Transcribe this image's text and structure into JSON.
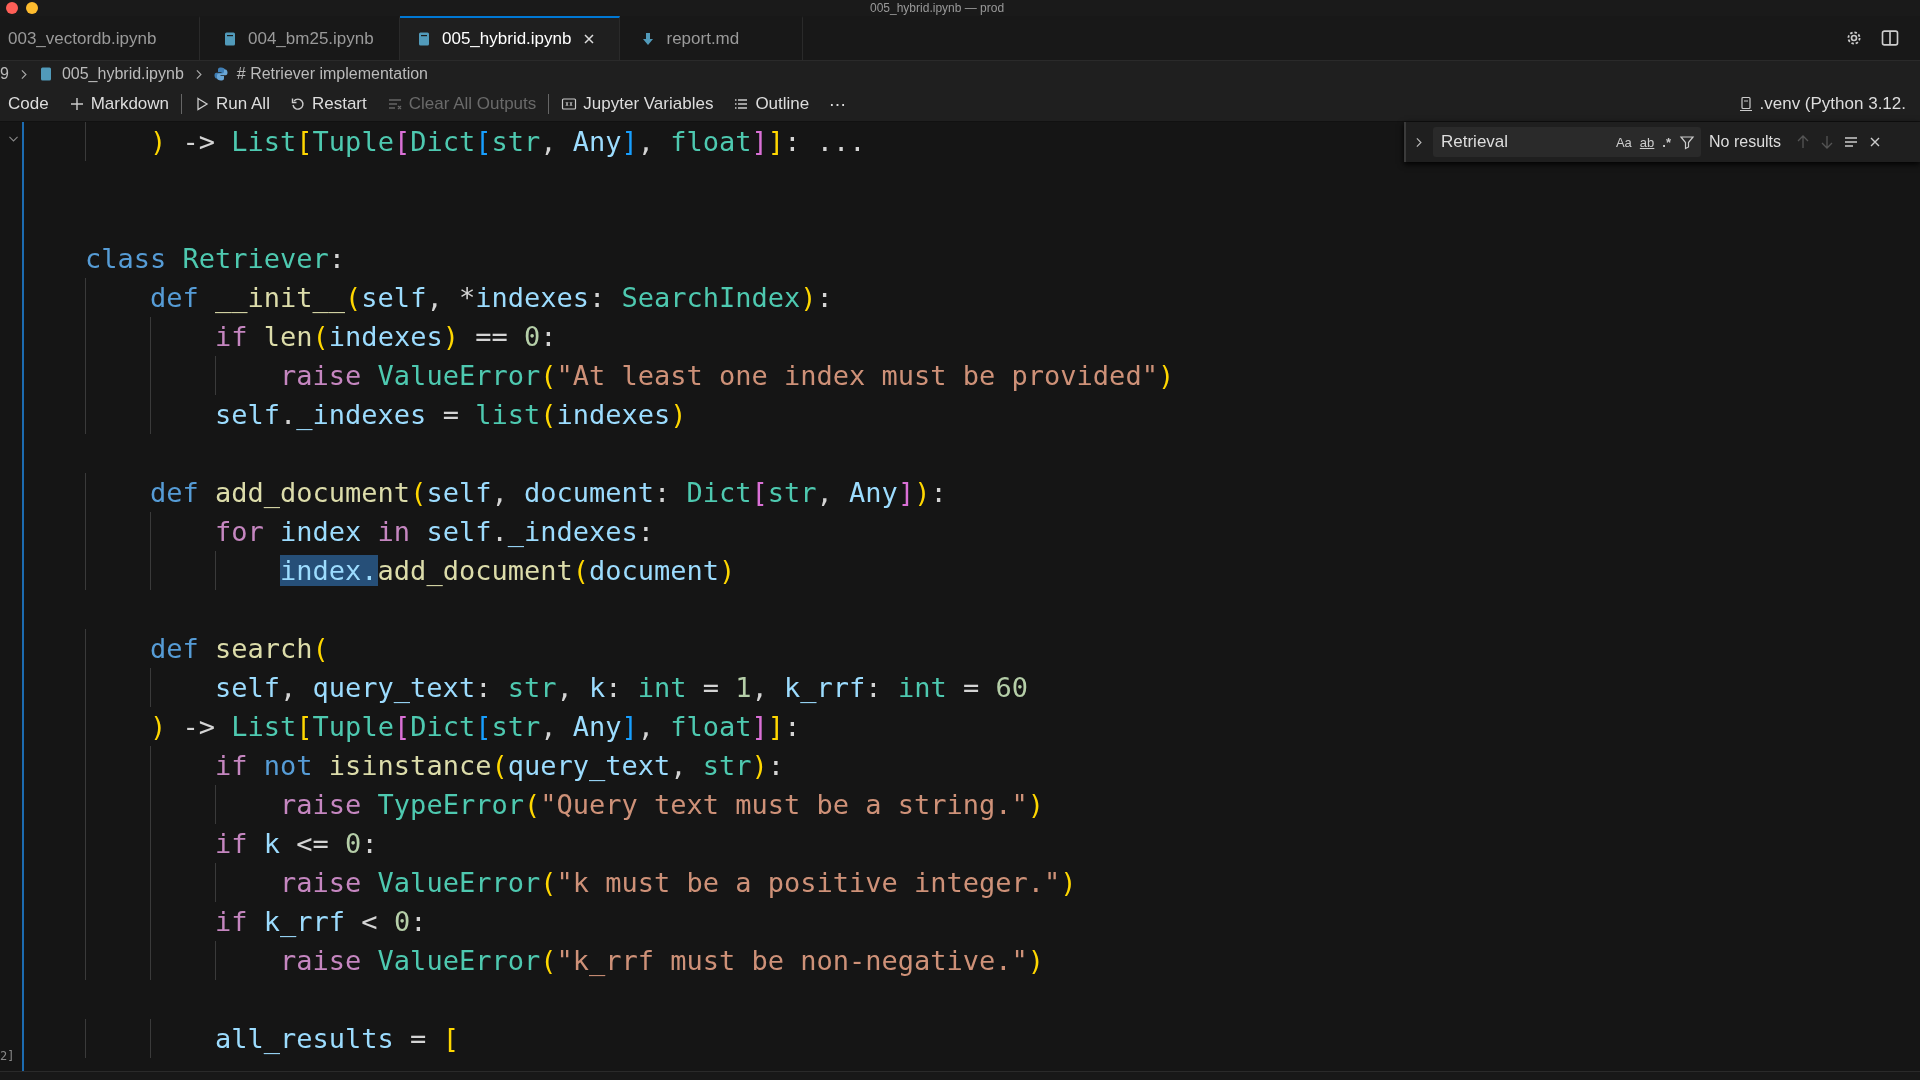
{
  "window": {
    "title": "005_hybrid.ipynb — prod"
  },
  "tabs": [
    {
      "label": "003_vectordb.ipynb",
      "kind": "plain",
      "selected": false
    },
    {
      "label": "004_bm25.ipynb",
      "kind": "notebook",
      "selected": false
    },
    {
      "label": "005_hybrid.ipynb",
      "kind": "notebook",
      "selected": true
    },
    {
      "label": "report.md",
      "kind": "markdown",
      "selected": false
    }
  ],
  "breadcrumb": [
    {
      "label": "9",
      "kind": "plain"
    },
    {
      "label": "005_hybrid.ipynb",
      "kind": "notebook"
    },
    {
      "label": "# Retriever implementation",
      "kind": "python"
    }
  ],
  "toolbar": [
    {
      "label": "Code",
      "kind": "plain",
      "disabled": false
    },
    {
      "label": "Markdown",
      "kind": "plus",
      "disabled": false
    },
    {
      "kind": "separator"
    },
    {
      "label": "Run All",
      "kind": "run",
      "disabled": false
    },
    {
      "label": "Restart",
      "kind": "restart",
      "disabled": false
    },
    {
      "label": "Clear All Outputs",
      "kind": "clear",
      "disabled": true
    },
    {
      "kind": "separator"
    },
    {
      "label": "Jupyter Variables",
      "kind": "variables",
      "disabled": false
    },
    {
      "label": "Outline",
      "kind": "outline",
      "disabled": false
    },
    {
      "label": "⋯",
      "kind": "plain",
      "disabled": false
    }
  ],
  "kernel": {
    "label": ".venv (Python 3.12."
  },
  "find": {
    "value": "Retrieval",
    "options": [
      "Aa",
      "ab",
      ".*"
    ],
    "result": "No results"
  },
  "cell_label": "2]",
  "code": [
    {
      "kind": "group",
      "children": [
        {
          "kind": "code",
          "tokens": [
            {
              "kind": "b1",
              "text": ")"
            },
            {
              "kind": "op",
              "text": " -> "
            },
            {
              "kind": "cls",
              "text": "List"
            },
            {
              "kind": "b1",
              "text": "["
            },
            {
              "kind": "cls",
              "text": "Tuple"
            },
            {
              "kind": "b2",
              "text": "["
            },
            {
              "kind": "cls",
              "text": "Dict"
            },
            {
              "kind": "b3",
              "text": "["
            },
            {
              "kind": "cls",
              "text": "str"
            },
            {
              "kind": "op",
              "text": ", "
            },
            {
              "kind": "var",
              "text": "Any"
            },
            {
              "kind": "b3",
              "text": "]"
            },
            {
              "kind": "op",
              "text": ", "
            },
            {
              "kind": "cls",
              "text": "float"
            },
            {
              "kind": "b2",
              "text": "]"
            },
            {
              "kind": "b1",
              "text": "]"
            },
            {
              "kind": "op",
              "text": ": ..."
            }
          ]
        }
      ]
    },
    {
      "kind": "blank"
    },
    {
      "kind": "blank"
    },
    {
      "kind": "code",
      "tokens": [
        {
          "kind": "kw",
          "text": "class "
        },
        {
          "kind": "cls",
          "text": "Retriever"
        },
        {
          "kind": "op",
          "text": ":"
        }
      ],
      "children": [
        {
          "kind": "code",
          "tokens": [
            {
              "kind": "kw",
              "text": "def "
            },
            {
              "kind": "fn",
              "text": "__init__"
            },
            {
              "kind": "b1",
              "text": "("
            },
            {
              "kind": "var",
              "text": "self"
            },
            {
              "kind": "op",
              "text": ", *"
            },
            {
              "kind": "var",
              "text": "indexes"
            },
            {
              "kind": "op",
              "text": ": "
            },
            {
              "kind": "cls",
              "text": "SearchIndex"
            },
            {
              "kind": "b1",
              "text": ")"
            },
            {
              "kind": "op",
              "text": ":"
            }
          ],
          "children": [
            {
              "kind": "code",
              "tokens": [
                {
                  "kind": "ctl",
                  "text": "if "
                },
                {
                  "kind": "fn",
                  "text": "len"
                },
                {
                  "kind": "b1",
                  "text": "("
                },
                {
                  "kind": "var",
                  "text": "indexes"
                },
                {
                  "kind": "b1",
                  "text": ")"
                },
                {
                  "kind": "op",
                  "text": " == "
                },
                {
                  "kind": "num",
                  "text": "0"
                },
                {
                  "kind": "op",
                  "text": ":"
                }
              ],
              "children": [
                {
                  "kind": "code",
                  "tokens": [
                    {
                      "kind": "ctl",
                      "text": "raise "
                    },
                    {
                      "kind": "cls",
                      "text": "ValueError"
                    },
                    {
                      "kind": "b1",
                      "text": "("
                    },
                    {
                      "kind": "str",
                      "text": "\"At least one index must be provided\""
                    },
                    {
                      "kind": "b1",
                      "text": ")"
                    }
                  ]
                }
              ]
            },
            {
              "kind": "code",
              "tokens": [
                {
                  "kind": "var",
                  "text": "self"
                },
                {
                  "kind": "op",
                  "text": "."
                },
                {
                  "kind": "var",
                  "text": "_indexes"
                },
                {
                  "kind": "op",
                  "text": " = "
                },
                {
                  "kind": "cls",
                  "text": "list"
                },
                {
                  "kind": "b1",
                  "text": "("
                },
                {
                  "kind": "var",
                  "text": "indexes"
                },
                {
                  "kind": "b1",
                  "text": ")"
                }
              ]
            }
          ]
        },
        {
          "kind": "blank"
        },
        {
          "kind": "code",
          "tokens": [
            {
              "kind": "kw",
              "text": "def "
            },
            {
              "kind": "fn",
              "text": "add_document"
            },
            {
              "kind": "b1",
              "text": "("
            },
            {
              "kind": "var",
              "text": "self"
            },
            {
              "kind": "op",
              "text": ", "
            },
            {
              "kind": "var",
              "text": "document"
            },
            {
              "kind": "op",
              "text": ": "
            },
            {
              "kind": "cls",
              "text": "Dict"
            },
            {
              "kind": "b2",
              "text": "["
            },
            {
              "kind": "cls",
              "text": "str"
            },
            {
              "kind": "op",
              "text": ", "
            },
            {
              "kind": "var",
              "text": "Any"
            },
            {
              "kind": "b2",
              "text": "]"
            },
            {
              "kind": "b1",
              "text": ")"
            },
            {
              "kind": "op",
              "text": ":"
            }
          ],
          "children": [
            {
              "kind": "code",
              "tokens": [
                {
                  "kind": "ctl",
                  "text": "for "
                },
                {
                  "kind": "var",
                  "text": "index"
                },
                {
                  "kind": "ctl",
                  "text": " in "
                },
                {
                  "kind": "var",
                  "text": "self"
                },
                {
                  "kind": "op",
                  "text": "."
                },
                {
                  "kind": "var",
                  "text": "_indexes"
                },
                {
                  "kind": "op",
                  "text": ":"
                }
              ],
              "children": [
                {
                  "kind": "code",
                  "tokens": [
                    {
                      "kind": "selected",
                      "text": "index."
                    },
                    {
                      "kind": "fn",
                      "text": "add_document"
                    },
                    {
                      "kind": "b1",
                      "text": "("
                    },
                    {
                      "kind": "var",
                      "text": "document"
                    },
                    {
                      "kind": "b1",
                      "text": ")"
                    }
                  ]
                }
              ]
            }
          ]
        },
        {
          "kind": "blank"
        },
        {
          "kind": "code",
          "tokens": [
            {
              "kind": "kw",
              "text": "def "
            },
            {
              "kind": "fn",
              "text": "search"
            },
            {
              "kind": "b1",
              "text": "("
            }
          ],
          "children": [
            {
              "kind": "code",
              "tokens": [
                {
                  "kind": "var",
                  "text": "self"
                },
                {
                  "kind": "op",
                  "text": ", "
                },
                {
                  "kind": "var",
                  "text": "query_text"
                },
                {
                  "kind": "op",
                  "text": ": "
                },
                {
                  "kind": "cls",
                  "text": "str"
                },
                {
                  "kind": "op",
                  "text": ", "
                },
                {
                  "kind": "var",
                  "text": "k"
                },
                {
                  "kind": "op",
                  "text": ": "
                },
                {
                  "kind": "cls",
                  "text": "int"
                },
                {
                  "kind": "op",
                  "text": " = "
                },
                {
                  "kind": "num",
                  "text": "1"
                },
                {
                  "kind": "op",
                  "text": ", "
                },
                {
                  "kind": "var",
                  "text": "k_rrf"
                },
                {
                  "kind": "op",
                  "text": ": "
                },
                {
                  "kind": "cls",
                  "text": "int"
                },
                {
                  "kind": "op",
                  "text": " = "
                },
                {
                  "kind": "num",
                  "text": "60"
                }
              ]
            }
          ]
        },
        {
          "kind": "code",
          "tokens": [
            {
              "kind": "b1",
              "text": ")"
            },
            {
              "kind": "op",
              "text": " -> "
            },
            {
              "kind": "cls",
              "text": "List"
            },
            {
              "kind": "b1",
              "text": "["
            },
            {
              "kind": "cls",
              "text": "Tuple"
            },
            {
              "kind": "b2",
              "text": "["
            },
            {
              "kind": "cls",
              "text": "Dict"
            },
            {
              "kind": "b3",
              "text": "["
            },
            {
              "kind": "cls",
              "text": "str"
            },
            {
              "kind": "op",
              "text": ", "
            },
            {
              "kind": "var",
              "text": "Any"
            },
            {
              "kind": "b3",
              "text": "]"
            },
            {
              "kind": "op",
              "text": ", "
            },
            {
              "kind": "cls",
              "text": "float"
            },
            {
              "kind": "b2",
              "text": "]"
            },
            {
              "kind": "b1",
              "text": "]"
            },
            {
              "kind": "op",
              "text": ":"
            }
          ],
          "children": [
            {
              "kind": "code",
              "tokens": [
                {
                  "kind": "ctl",
                  "text": "if "
                },
                {
                  "kind": "kw",
                  "text": "not "
                },
                {
                  "kind": "fn",
                  "text": "isinstance"
                },
                {
                  "kind": "b1",
                  "text": "("
                },
                {
                  "kind": "var",
                  "text": "query_text"
                },
                {
                  "kind": "op",
                  "text": ", "
                },
                {
                  "kind": "cls",
                  "text": "str"
                },
                {
                  "kind": "b1",
                  "text": ")"
                },
                {
                  "kind": "op",
                  "text": ":"
                }
              ],
              "children": [
                {
                  "kind": "code",
                  "tokens": [
                    {
                      "kind": "ctl",
                      "text": "raise "
                    },
                    {
                      "kind": "cls",
                      "text": "TypeError"
                    },
                    {
                      "kind": "b1",
                      "text": "("
                    },
                    {
                      "kind": "str",
                      "text": "\"Query text must be a string.\""
                    },
                    {
                      "kind": "b1",
                      "text": ")"
                    }
                  ]
                }
              ]
            },
            {
              "kind": "code",
              "tokens": [
                {
                  "kind": "ctl",
                  "text": "if "
                },
                {
                  "kind": "var",
                  "text": "k"
                },
                {
                  "kind": "op",
                  "text": " <= "
                },
                {
                  "kind": "num",
                  "text": "0"
                },
                {
                  "kind": "op",
                  "text": ":"
                }
              ],
              "children": [
                {
                  "kind": "code",
                  "tokens": [
                    {
                      "kind": "ctl",
                      "text": "raise "
                    },
                    {
                      "kind": "cls",
                      "text": "ValueError"
                    },
                    {
                      "kind": "b1",
                      "text": "("
                    },
                    {
                      "kind": "str",
                      "text": "\"k must be a positive integer.\""
                    },
                    {
                      "kind": "b1",
                      "text": ")"
                    }
                  ]
                }
              ]
            },
            {
              "kind": "code",
              "tokens": [
                {
                  "kind": "ctl",
                  "text": "if "
                },
                {
                  "kind": "var",
                  "text": "k_rrf"
                },
                {
                  "kind": "op",
                  "text": " < "
                },
                {
                  "kind": "num",
                  "text": "0"
                },
                {
                  "kind": "op",
                  "text": ":"
                }
              ],
              "children": [
                {
                  "kind": "code",
                  "tokens": [
                    {
                      "kind": "ctl",
                      "text": "raise "
                    },
                    {
                      "kind": "cls",
                      "text": "ValueError"
                    },
                    {
                      "kind": "b1",
                      "text": "("
                    },
                    {
                      "kind": "str",
                      "text": "\"k_rrf must be non-negative.\""
                    },
                    {
                      "kind": "b1",
                      "text": ")"
                    }
                  ]
                }
              ]
            },
            {
              "kind": "blank"
            },
            {
              "kind": "code",
              "tokens": [
                {
                  "kind": "var",
                  "text": "all_results"
                },
                {
                  "kind": "op",
                  "text": " = "
                },
                {
                  "kind": "b1",
                  "text": "["
                }
              ]
            }
          ]
        }
      ]
    }
  ]
}
